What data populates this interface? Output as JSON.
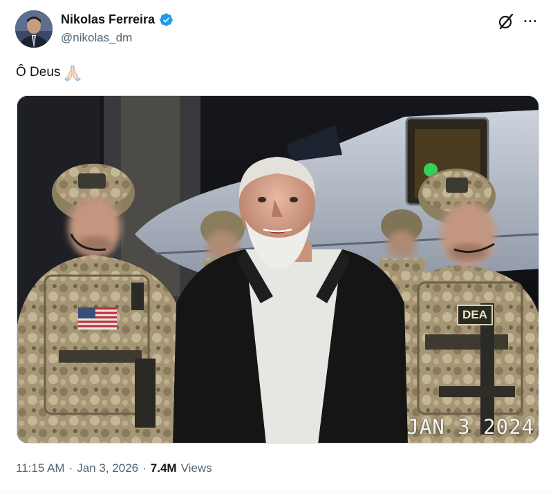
{
  "author": {
    "name": "Nikolas Ferreira",
    "handle": "@nikolas_dm",
    "verified": true,
    "verified_color": "#1d9bf0"
  },
  "tweet": {
    "text": "Ô Deus",
    "emoji": "folded-hands"
  },
  "media": {
    "date_stamp": "JAN 3 2024",
    "patch_text": "DEA"
  },
  "meta": {
    "time": "11:15 AM",
    "separator": "·",
    "date": "Jan 3, 2026",
    "views_count": "7.4M",
    "views_label": "Views"
  },
  "icons": {
    "grok": "grok-icon",
    "more": "more-icon"
  },
  "more_glyph": "···"
}
